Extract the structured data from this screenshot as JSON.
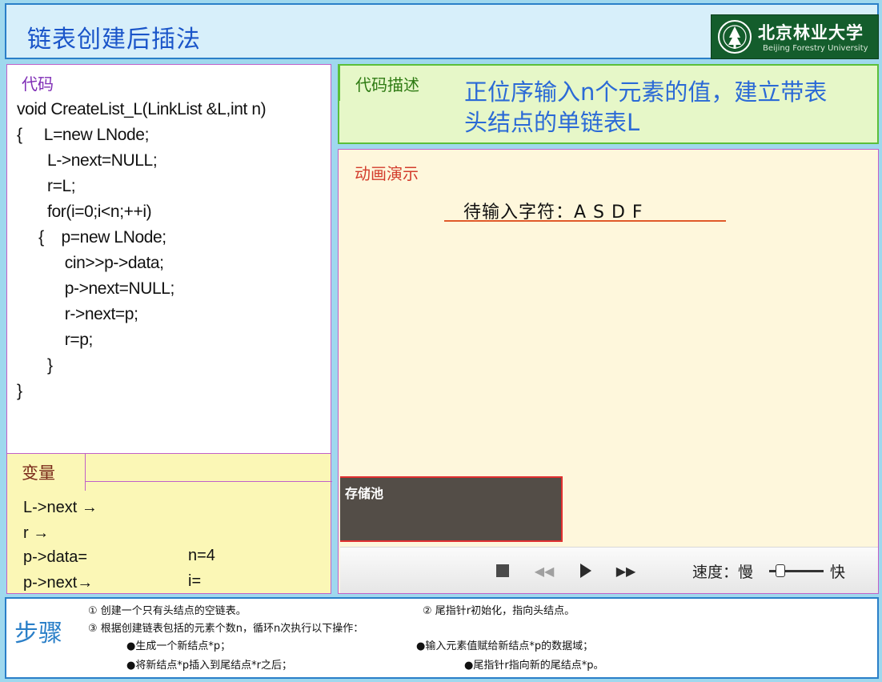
{
  "title": "链表创建后插法",
  "logo": {
    "cn": "北京林业大学",
    "en": "Beijing Forestry University"
  },
  "code_panel": {
    "heading": "代码",
    "lines": [
      "void CreateList_L(LinkList &L,int n)",
      "{     L=new LNode;",
      "       L->next=NULL;",
      "       r=L;",
      "       for(i=0;i<n;++i)",
      "     {    p=new LNode;",
      "           cin>>p->data;",
      "           p->next=NULL;",
      "           r->next=p;",
      "           r=p;",
      "       }",
      "}"
    ]
  },
  "var_panel": {
    "heading": "变量",
    "lines": [
      "L->next →",
      "r →",
      "p->data=",
      "p->next→"
    ],
    "n_label": "n=4",
    "i_label": "i="
  },
  "desc_panel": {
    "heading": "代码描述",
    "text": "正位序输入n个元素的值，建立带表头结点的单链表L"
  },
  "anim_panel": {
    "heading": "动画演示",
    "pending": "待输入字符：A  S  D  F",
    "pool_label": "存储池",
    "speed_label": "速度：慢",
    "fast_label": "快",
    "speed_value": 0.15,
    "accent_color": "#e05a2a"
  },
  "steps_panel": {
    "heading": "步骤",
    "lines": [
      "①  创建一个只有头结点的空链表。",
      "②  尾指针r初始化，指向头结点。",
      "③  根据创建链表包括的元素个数n，循环n次执行以下操作：",
      "●生成一个新结点*p；",
      "●输入元素值赋给新结点*p的数据域；",
      "●将新结点*p插入到尾结点*r之后；",
      "●尾指针r指向新的尾结点*p。"
    ]
  },
  "icons": [
    "emblem-icon",
    "stop-icon",
    "rewind-icon",
    "play-icon",
    "fast-forward-icon"
  ]
}
